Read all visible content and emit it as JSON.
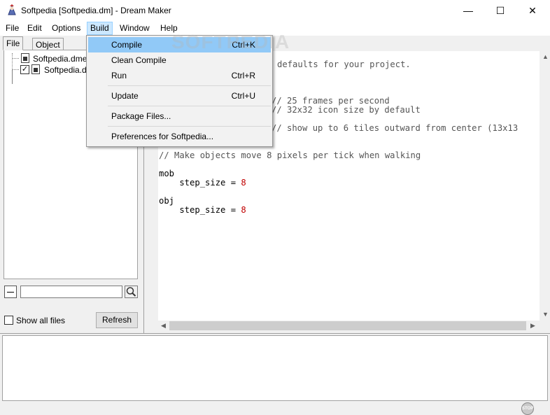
{
  "window": {
    "title": "Softpedia [Softpedia.dm] - Dream Maker",
    "minimize_glyph": "—",
    "maximize_glyph": "☐",
    "close_glyph": "✕"
  },
  "menubar": {
    "items": [
      "File",
      "Edit",
      "Options",
      "Build",
      "Window",
      "Help"
    ]
  },
  "build_menu": {
    "items": [
      {
        "label": "Compile",
        "shortcut": "Ctrl+K"
      },
      {
        "label": "Clean Compile",
        "shortcut": ""
      },
      {
        "label": "Run",
        "shortcut": "Ctrl+R"
      },
      {
        "label": "Update",
        "shortcut": "Ctrl+U"
      },
      {
        "label": "Package Files...",
        "shortcut": ""
      },
      {
        "label": "Preferences for Softpedia...",
        "shortcut": ""
      }
    ]
  },
  "left_panel": {
    "tabs": [
      "File",
      "Object"
    ],
    "tree": [
      {
        "label": "Softpedia.dme",
        "checked": false
      },
      {
        "label": "Softpedia.dm",
        "checked": true
      }
    ],
    "search": {
      "value": ""
    },
    "show_all_label": "Show all files",
    "refresh_label": "Refresh"
  },
  "editor": {
    "lines": [
      {
        "prefix": "",
        "comment": "defaults for your project.",
        "num": ""
      },
      {
        "prefix": "",
        "comment": "// 25 frames per second",
        "num": ""
      },
      {
        "prefix": "",
        "comment": "// 32x32 icon size by default",
        "num": ""
      },
      {
        "prefix": "",
        "comment": "// show up to 6 tiles outward from center (13x13",
        "num": ""
      },
      {
        "prefix": "",
        "comment": "// Make objects move 8 pixels per tick when walking",
        "num": ""
      },
      {
        "prefix": "mob",
        "comment": "",
        "num": ""
      },
      {
        "prefix": "    step_size = ",
        "comment": "",
        "num": "8"
      },
      {
        "prefix": "obj",
        "comment": "",
        "num": ""
      },
      {
        "prefix": "    step_size = ",
        "comment": "",
        "num": "8"
      }
    ]
  },
  "watermark": "SOFTPEDIA",
  "stop_label": "STOP",
  "icons": {
    "app": "dream-maker-icon",
    "search": "magnifier-icon",
    "stop": "stop-icon"
  },
  "colors": {
    "menu_highlight": "#91c9f7",
    "number": "#c00000"
  }
}
